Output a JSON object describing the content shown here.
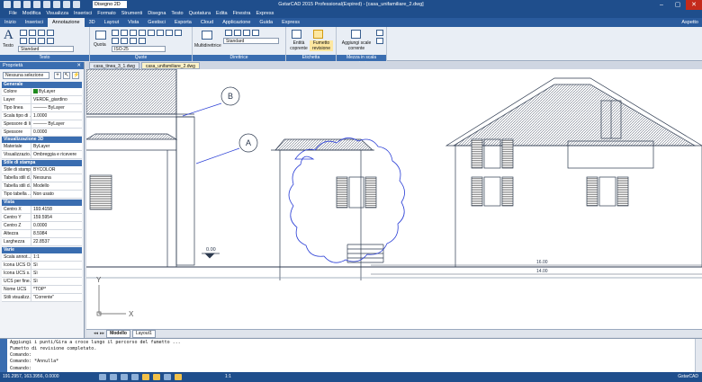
{
  "titlebar": {
    "workspace": "Disegno 2D",
    "title": "GstarCAD 2015 Professional(Expired) - [casa_unifamiliare_2.dwg]",
    "minimize": "–",
    "maximize": "▢",
    "close": "✕"
  },
  "menubar": [
    "File",
    "Modifica",
    "Visualizza",
    "Inserisci",
    "Formato",
    "Strumenti",
    "Disegna",
    "Testo",
    "Quotatura",
    "Edita",
    "Finestra",
    "Express"
  ],
  "ribbon_tabs": [
    "Inizio",
    "Inserisci",
    "Annotazione",
    "3D",
    "Layout",
    "Vista",
    "Gestisci",
    "Esporta",
    "Cloud",
    "Applicazione",
    "Guida",
    "Express"
  ],
  "active_ribbon_tab": "Annotazione",
  "ribbon_tabs_right": "Aspetto",
  "ribbon": {
    "text_panel": {
      "big_label": "Testo",
      "style": "Standard",
      "footer": "Testo"
    },
    "dim_panel": {
      "big_label": "Quota",
      "style": "ISO-25",
      "footer": "Quote"
    },
    "leader_panel": {
      "big_label": "Multidirettrice",
      "style": "Standard",
      "footer": "Direttrice"
    },
    "markup_panel": {
      "wipeout": "Entità coprente",
      "revcloud": "Fumetto revisione",
      "footer": "Etichetta"
    },
    "scale_panel": {
      "add_scale": "Aggiungi scale corrente",
      "footer": "Mezza in scala annotazione"
    }
  },
  "doc_tabs": [
    "casa_tinea_3_1.dwg",
    "casa_unifamiliare_2.dwg"
  ],
  "active_doc_tab": "casa_unifamiliare_2.dwg",
  "properties": {
    "header": "Proprietà",
    "selection": "Nessuna selezione",
    "sections": [
      {
        "title": "Generale",
        "rows": [
          [
            "Colore",
            "ByLayer"
          ],
          [
            "Layer",
            "VERDE_giardino"
          ],
          [
            "Tipo linea",
            "——— ByLayer"
          ],
          [
            "Scala tipo di ...",
            "1.0000"
          ],
          [
            "Spessore di li...",
            "——— ByLayer"
          ],
          [
            "Spessore",
            "0.0000"
          ]
        ]
      },
      {
        "title": "Visualizzazione 3D",
        "rows": [
          [
            "Materiale",
            "ByLayer"
          ],
          [
            "Visualizzazio...",
            "Ombreggia e ricevere"
          ]
        ]
      },
      {
        "title": "Stile di stampa",
        "rows": [
          [
            "Stile di stampa",
            "BYCOLOR"
          ],
          [
            "Tabella stili d...",
            "Nessuna"
          ],
          [
            "Tabella stili d...",
            "Modello"
          ],
          [
            "Tipo tabella ...",
            "Non usato"
          ]
        ]
      },
      {
        "title": "Vista",
        "rows": [
          [
            "Centro X",
            "193.4158"
          ],
          [
            "Centro Y",
            "159.5954"
          ],
          [
            "Centro Z",
            "0.0000"
          ],
          [
            "Altezza",
            "8.5984"
          ],
          [
            "Larghezza",
            "22.8537"
          ]
        ]
      },
      {
        "title": "Varie",
        "rows": [
          [
            "Scala annot...",
            "1:1"
          ],
          [
            "Icona UCS On",
            "Sì"
          ],
          [
            "Icona UCS s...",
            "Sì"
          ],
          [
            "UCS per fine...",
            "Sì"
          ],
          [
            "Nome UCS",
            "*TOP*"
          ],
          [
            "Stili visualizz...",
            "\"Corrente\""
          ]
        ]
      }
    ]
  },
  "drawing": {
    "label_a": "A",
    "label_b": "B",
    "level": "0.00",
    "dim_top": "16.00",
    "dim_bottom": "14.00",
    "ucs_x": "X",
    "ucs_y": "Y"
  },
  "model_tabs": [
    "Modello",
    "Layout1"
  ],
  "active_model_tab": "Modello",
  "command": {
    "lines": [
      "Aggiungi i punti/Gira a croce lungo il percorso del fumetto ...",
      "Fumetto di revisione completato.",
      "Comando:",
      "Comando: *Annulla*",
      "Comando:"
    ]
  },
  "status": {
    "coords": "191.2957, 163.3956, 0.0000",
    "scale": "1:1",
    "brand": "GstarCAD"
  },
  "colors": {
    "title_bar": "#1f4e8c",
    "drawing_lines": "#2d3a4f",
    "markup_blue": "#2b3fd6",
    "accent": "#3a6db0"
  }
}
